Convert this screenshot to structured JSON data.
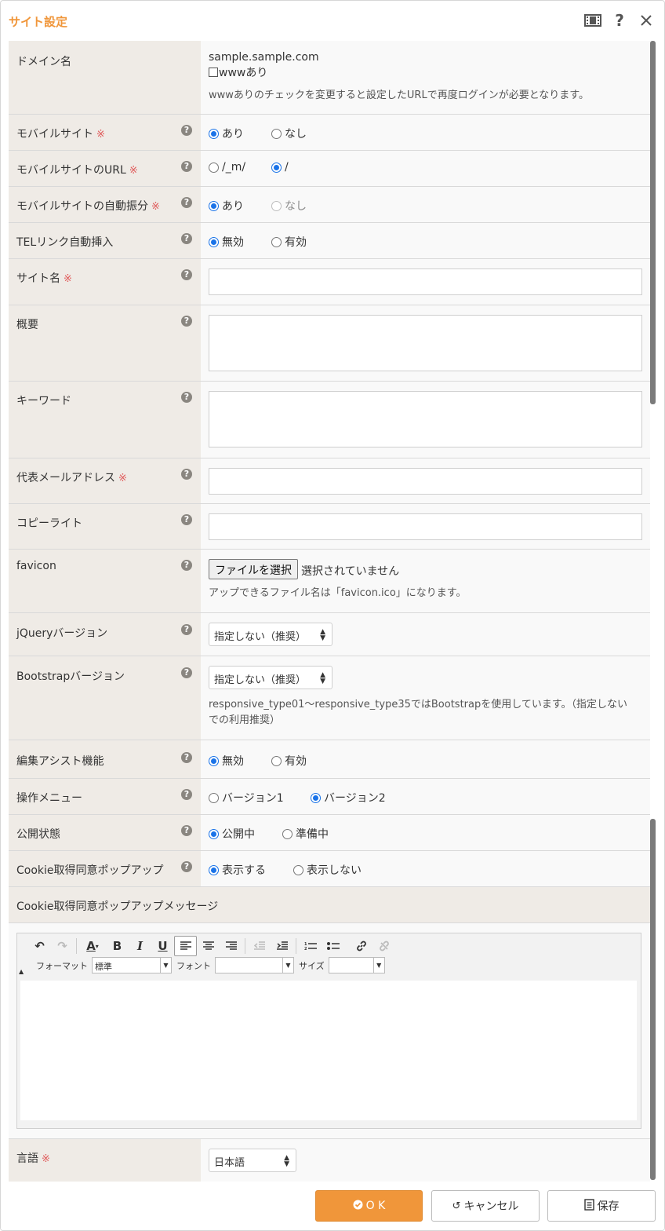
{
  "dialog": {
    "title": "サイト設定",
    "icons": [
      "film-icon",
      "help-icon",
      "close-icon"
    ]
  },
  "domain": {
    "label": "ドメイン名",
    "value": "sample.sample.com",
    "www_checkbox_label": "wwwあり",
    "www_checked": false,
    "note": "wwwありのチェックを変更すると設定したURLで再度ログインが必要となります。"
  },
  "mobile_site": {
    "label": "モバイルサイト",
    "required_mark": "※",
    "options": [
      "あり",
      "なし"
    ],
    "selected": "あり"
  },
  "mobile_url": {
    "label": "モバイルサイトのURL",
    "required_mark": "※",
    "options": [
      "/_m/",
      "/"
    ],
    "selected": "/"
  },
  "mobile_redirect": {
    "label": "モバイルサイトの自動振分",
    "required_mark": "※",
    "options": [
      "あり",
      "なし"
    ],
    "selected": "あり",
    "disabled_option": "なし"
  },
  "tel_link": {
    "label": "TELリンク自動挿入",
    "options": [
      "無効",
      "有効"
    ],
    "selected": "無効"
  },
  "site_name": {
    "label": "サイト名",
    "required_mark": "※",
    "value": ""
  },
  "summary": {
    "label": "概要",
    "value": ""
  },
  "keywords": {
    "label": "キーワード",
    "value": ""
  },
  "email": {
    "label": "代表メールアドレス",
    "required_mark": "※",
    "value": ""
  },
  "copyright": {
    "label": "コピーライト",
    "value": ""
  },
  "favicon": {
    "label": "favicon",
    "button_label": "ファイルを選択",
    "status": "選択されていません",
    "note": "アップできるファイル名は「favicon.ico」になります。"
  },
  "jquery": {
    "label": "jQueryバージョン",
    "selected": "指定しない（推奨）"
  },
  "bootstrap": {
    "label": "Bootstrapバージョン",
    "selected": "指定しない（推奨）",
    "note_line1": "responsive_type01〜responsive_type35ではBootstrapを使用しています。（指定しない",
    "note_line2": "での利用推奨）"
  },
  "edit_assist": {
    "label": "編集アシスト機能",
    "options": [
      "無効",
      "有効"
    ],
    "selected": "無効"
  },
  "operation_menu": {
    "label": "操作メニュー",
    "options": [
      "バージョン1",
      "バージョン2"
    ],
    "selected": "バージョン2"
  },
  "publish_state": {
    "label": "公開状態",
    "options": [
      "公開中",
      "準備中"
    ],
    "selected": "公開中"
  },
  "cookie_popup": {
    "label": "Cookie取得同意ポップアップ",
    "options": [
      "表示する",
      "表示しない"
    ],
    "selected": "表示する"
  },
  "cookie_message": {
    "label": "Cookie取得同意ポップアップメッセージ",
    "editor": {
      "format_label": "フォーマット",
      "format_value": "標準",
      "font_label": "フォント",
      "font_value": "",
      "size_label": "サイズ",
      "size_value": ""
    }
  },
  "language": {
    "label": "言語",
    "required_mark": "※",
    "selected": "日本語"
  },
  "help_glyph": "?",
  "footer": {
    "ok_label": "O K",
    "cancel_label": "キャンセル",
    "save_label": "保存"
  },
  "colors": {
    "accent": "#f0963a",
    "required": "#e05a5a",
    "label_bg": "#efebe6",
    "radio_on": "#1a73e8"
  }
}
